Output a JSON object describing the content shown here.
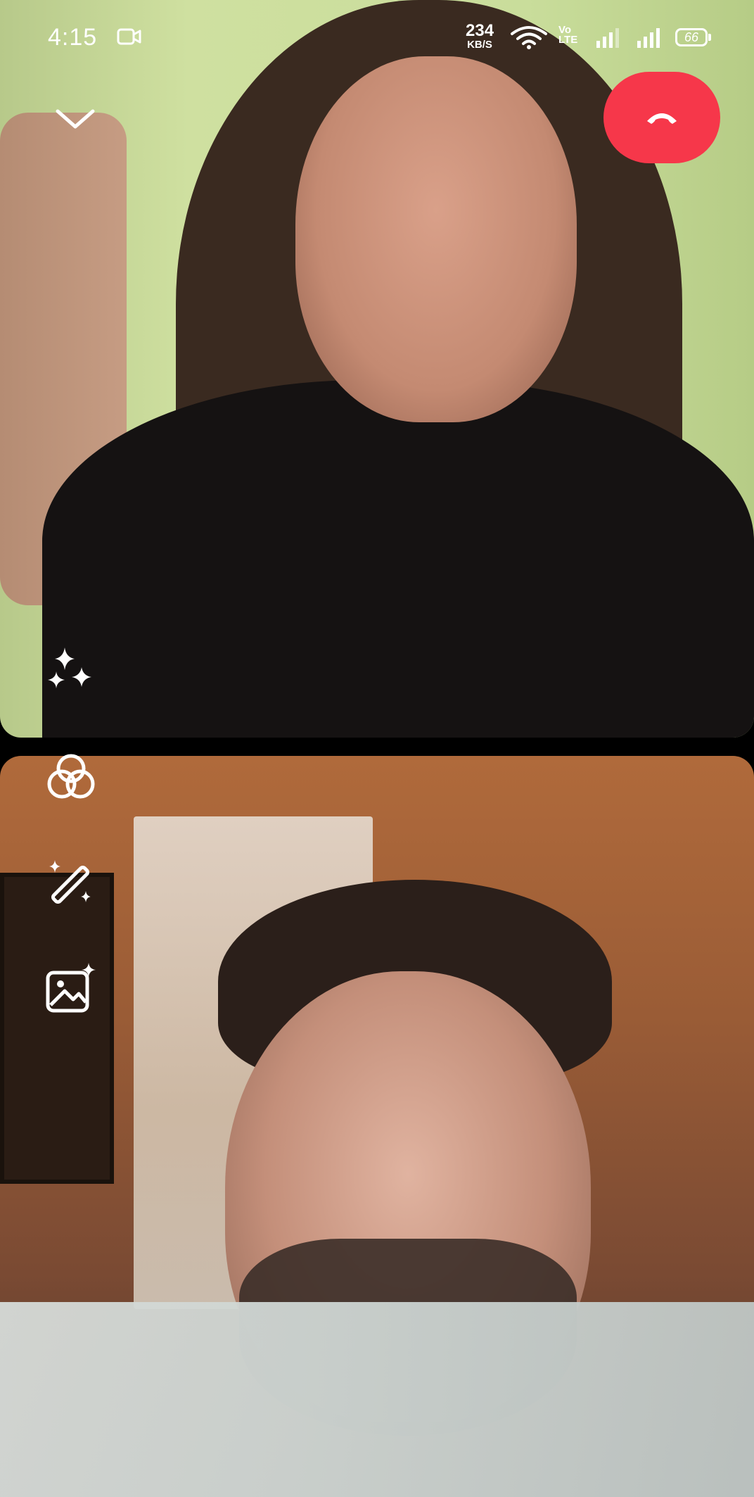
{
  "status_bar": {
    "time": "4:15",
    "network_speed_value": "234",
    "network_speed_unit": "KB/S",
    "volte_line1": "Vo",
    "volte_line2": "LTE",
    "battery_level": "66"
  },
  "icons": {
    "collapse": "chevron-down-icon",
    "end_call": "phone-hangup-icon",
    "effects": "sparkles-icon",
    "filters": "overlapping-circles-icon",
    "touch_up": "magic-wand-icon",
    "background": "image-sparkle-icon"
  },
  "colors": {
    "end_call_bg": "#f6374a",
    "icon": "#ffffff"
  }
}
